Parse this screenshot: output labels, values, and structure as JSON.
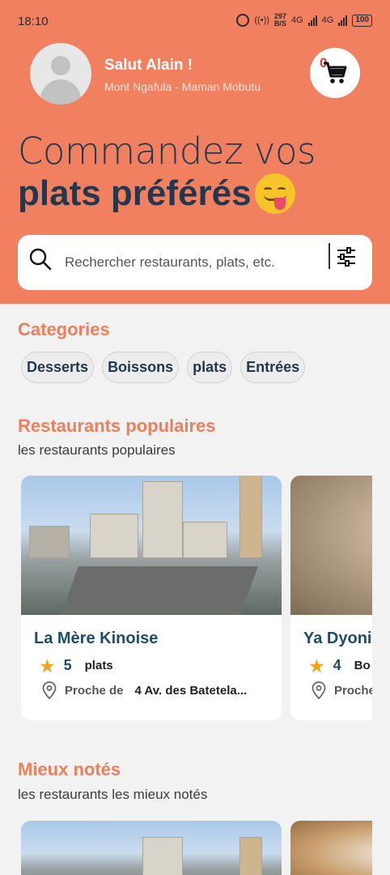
{
  "status_bar": {
    "time": "18:10",
    "net_speed_top": "297",
    "net_speed_bottom": "B/S",
    "signal1": "4G",
    "signal2": "4G",
    "battery": "100"
  },
  "header": {
    "greeting": "Salut Alain !",
    "location": "Mont Ngafula - Maman Mobutu",
    "cart_count": "0",
    "headline_line1": "Commandez vos",
    "headline_line2": "plats préférés",
    "emoji_icon": "face-savoring-food-emoji",
    "background_color": "#f08060"
  },
  "search": {
    "placeholder": "Rechercher restaurants, plats, etc."
  },
  "categories": {
    "title": "Categories",
    "items": [
      "Desserts",
      "Boissons",
      "plats",
      "Entrées"
    ]
  },
  "popular": {
    "title": "Restaurants populaires",
    "subtitle": "les restaurants populaires",
    "restaurants": [
      {
        "name": "La Mère Kinoise",
        "rating": "5",
        "rating_unit": "plats",
        "address_prefix": "Proche de",
        "address": "4 Av. des Batetela..."
      },
      {
        "name": "Ya Dyoni",
        "rating": "4",
        "rating_unit": "Bo",
        "address_prefix": "Proche",
        "address": ""
      }
    ]
  },
  "top_rated": {
    "title": "Mieux notés",
    "subtitle": "les restaurants les mieux notés"
  },
  "colors": {
    "accent": "#ee7f5c",
    "navy": "#22384f",
    "star": "#f4a11b"
  }
}
